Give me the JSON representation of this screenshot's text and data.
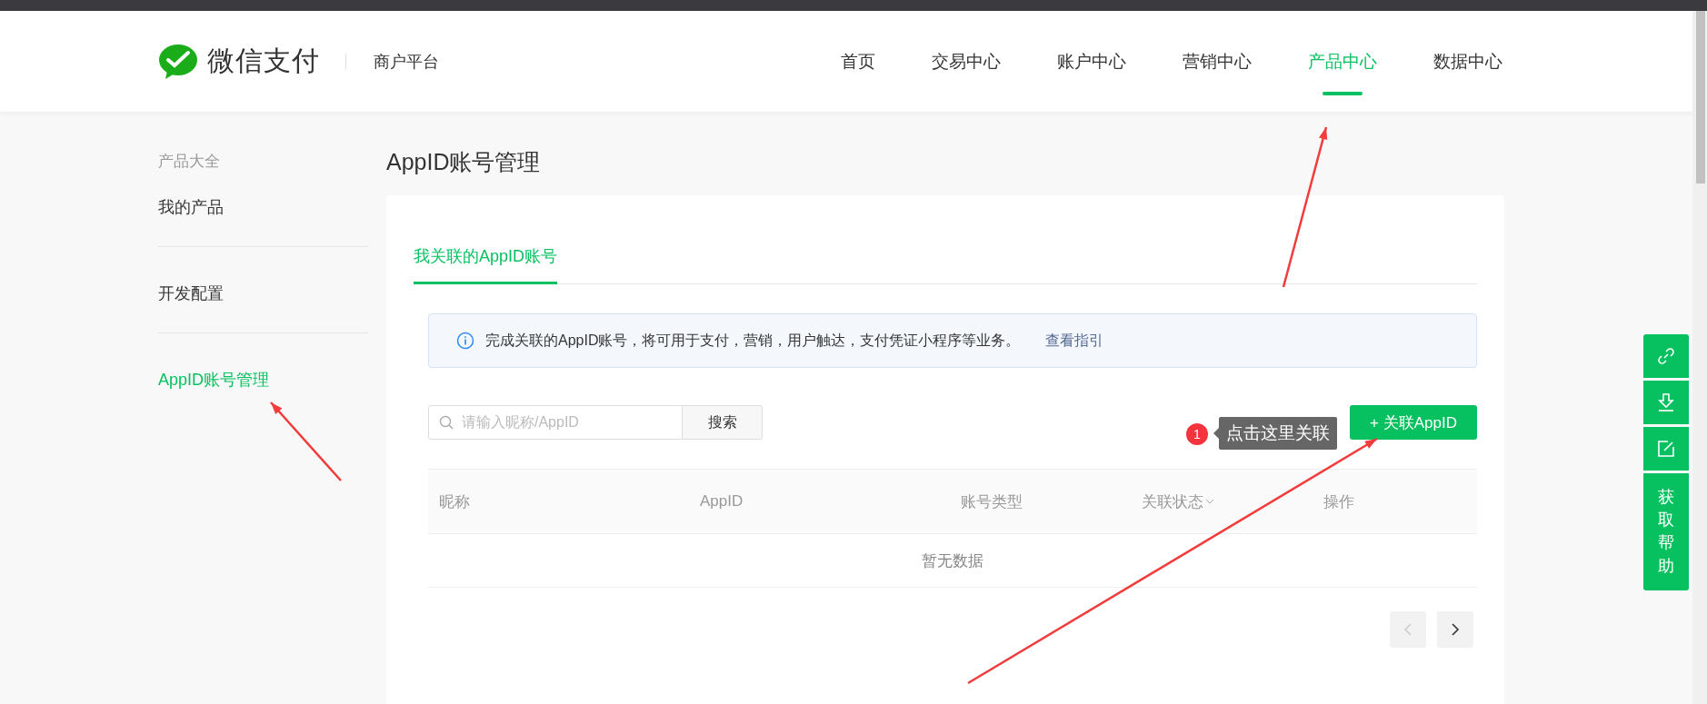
{
  "header": {
    "logo_text": "微信支付",
    "platform": "商户平台",
    "nav": [
      {
        "label": "首页",
        "selected": false
      },
      {
        "label": "交易中心",
        "selected": false
      },
      {
        "label": "账户中心",
        "selected": false
      },
      {
        "label": "营销中心",
        "selected": false
      },
      {
        "label": "产品中心",
        "selected": true
      },
      {
        "label": "数据中心",
        "selected": false
      }
    ]
  },
  "sidebar": {
    "groups": [
      {
        "items": [
          {
            "label": "产品大全",
            "kind": "heading",
            "selected": false
          },
          {
            "label": "我的产品",
            "kind": "item",
            "selected": false
          }
        ]
      },
      {
        "items": [
          {
            "label": "开发配置",
            "kind": "item",
            "selected": false
          }
        ]
      },
      {
        "items": [
          {
            "label": "AppID账号管理",
            "kind": "item",
            "selected": true
          }
        ]
      }
    ]
  },
  "page_title": "AppID账号管理",
  "tabs": [
    {
      "label": "我关联的AppID账号",
      "selected": true
    }
  ],
  "notice": {
    "text": "完成关联的AppID账号，将可用于支付，营销，用户触达，支付凭证小程序等业务。",
    "link": "查看指引"
  },
  "search": {
    "placeholder": "请输入昵称/AppID",
    "button": "搜索"
  },
  "hint": {
    "badge": "1",
    "text": "点击这里关联"
  },
  "add_button": "+ 关联AppID",
  "table": {
    "columns": [
      {
        "label": "昵称",
        "filter": false
      },
      {
        "label": "AppID",
        "filter": false
      },
      {
        "label": "账号类型",
        "filter": false
      },
      {
        "label": "关联状态",
        "filter": true
      },
      {
        "label": "操作",
        "filter": false
      }
    ],
    "empty_text": "暂无数据"
  },
  "pagination": {
    "prev": {
      "disabled": true
    },
    "next": {
      "disabled": false
    }
  },
  "float_toolbar": {
    "help_text": "获取帮助"
  }
}
